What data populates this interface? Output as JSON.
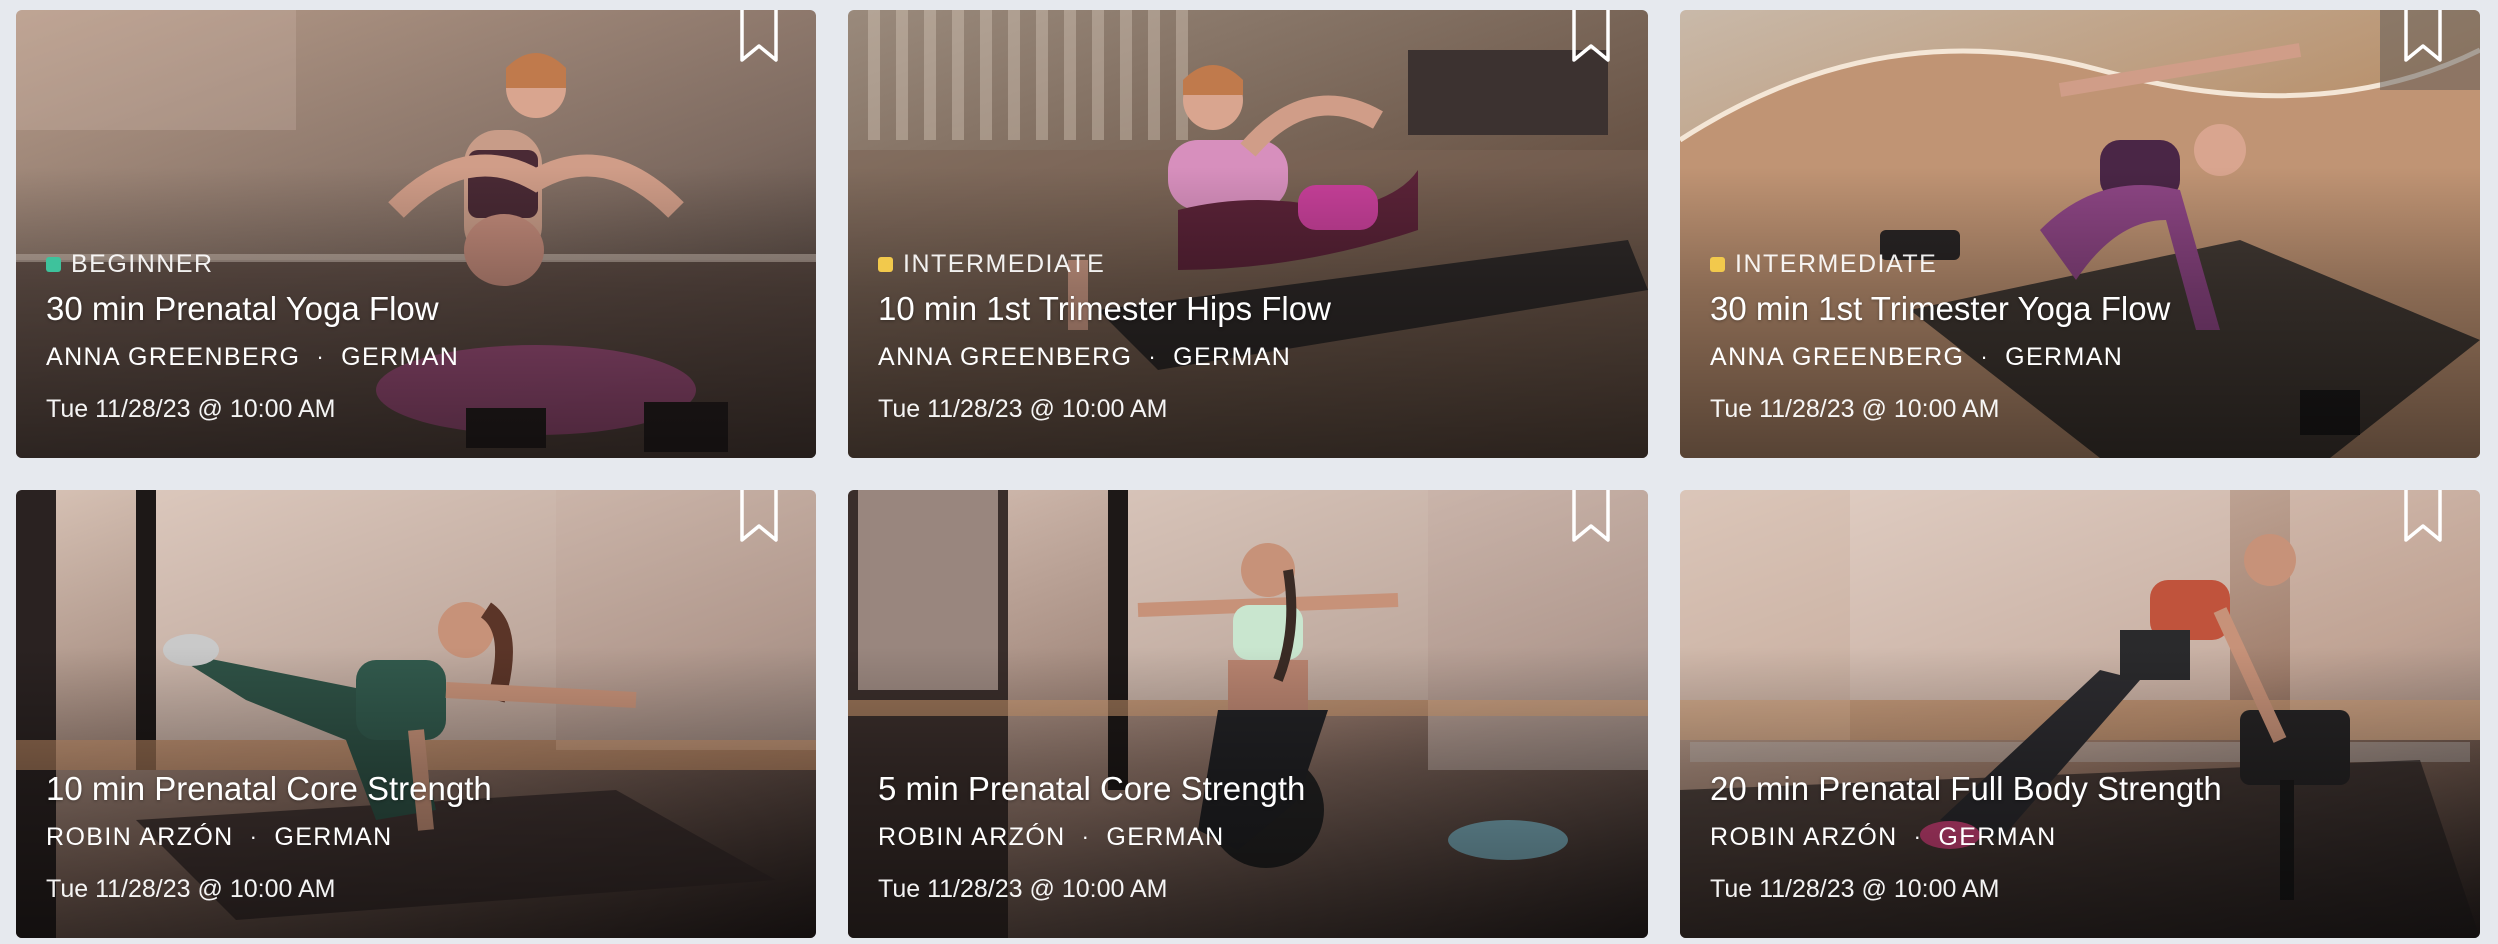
{
  "classes": [
    {
      "level": "BEGINNER",
      "level_color": "#3ec29c",
      "title": "30 min Prenatal Yoga Flow",
      "instructor": "ANNA GREENBERG",
      "language": "GERMAN",
      "separator": "·",
      "datetime": "Tue 11/28/23 @ 10:00 AM",
      "icon": "bookmark-icon",
      "palette": [
        "#b79c8a",
        "#7d6a60",
        "#3a302c"
      ]
    },
    {
      "level": "INTERMEDIATE",
      "level_color": "#f2c94c",
      "title": "10 min 1st Trimester Hips Flow",
      "instructor": "ANNA GREENBERG",
      "language": "GERMAN",
      "separator": "·",
      "datetime": "Tue 11/28/23 @ 10:00 AM",
      "icon": "bookmark-icon",
      "palette": [
        "#9a8a7c",
        "#6b5648",
        "#3c2f28"
      ]
    },
    {
      "level": "INTERMEDIATE",
      "level_color": "#f2c94c",
      "title": "30 min 1st Trimester Yoga Flow",
      "instructor": "ANNA GREENBERG",
      "language": "GERMAN",
      "separator": "·",
      "datetime": "Tue 11/28/23 @ 10:00 AM",
      "icon": "bookmark-icon",
      "palette": [
        "#c9b9a9",
        "#b58a62",
        "#5b4331"
      ]
    },
    {
      "level": "",
      "level_color": "",
      "title": "10 min Prenatal Core Strength",
      "instructor": "ROBIN ARZÓN",
      "language": "GERMAN",
      "separator": "·",
      "datetime": "Tue 11/28/23 @ 10:00 AM",
      "icon": "bookmark-icon",
      "palette": [
        "#d8c3b6",
        "#8a6f63",
        "#2a2120"
      ]
    },
    {
      "level": "",
      "level_color": "",
      "title": "5 min Prenatal Core Strength",
      "instructor": "ROBIN ARZÓN",
      "language": "GERMAN",
      "separator": "·",
      "datetime": "Tue 11/28/23 @ 10:00 AM",
      "icon": "bookmark-icon",
      "palette": [
        "#d6c0b4",
        "#8d7266",
        "#2b2322"
      ]
    },
    {
      "level": "",
      "level_color": "",
      "title": "20 min Prenatal Full Body Strength",
      "instructor": "ROBIN ARZÓN",
      "language": "GERMAN",
      "separator": "·",
      "datetime": "Tue 11/28/23 @ 10:00 AM",
      "icon": "bookmark-icon",
      "palette": [
        "#d9c5b8",
        "#a07e6c",
        "#2c2423"
      ]
    }
  ]
}
